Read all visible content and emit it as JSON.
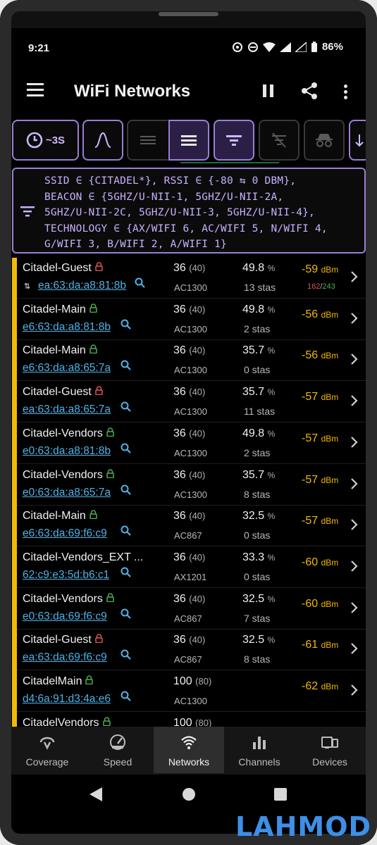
{
  "status": {
    "time": "9:21",
    "battery": "86%"
  },
  "appbar": {
    "title": "WiFi Networks"
  },
  "toolbar": {
    "interval": "~3S"
  },
  "filter": {
    "text": "SSID ∈ {CITADEL*}, RSSI ∈ {-80 ⇆ 0 DBM},\nBEACON ∈ {5GHZ/U-NII-1, 5GHZ/U-NII-2A,\n5GHZ/U-NII-2C, 5GHZ/U-NII-3, 5GHZ/U-NII-4},\nTECHNOLOGY ∈ {AX/WIFI 6, AC/WIFI 5, N/WIFI 4,\nG/WIFI 3, B/WIFI 2, A/WIFI 1}"
  },
  "networks": [
    {
      "ssid": "Citadel-Guest",
      "lock": "red",
      "bssid": "ea:63:da:a8:81:8b",
      "channel": "36",
      "width": "(40)",
      "standard": "AC1300",
      "util": "49.8",
      "util_unit": "%",
      "stas": "13 stas",
      "rssi": "-59",
      "rssi_unit": "dBm",
      "connected": true,
      "rate_rx": "162",
      "rate_tx": "243"
    },
    {
      "ssid": "Citadel-Main",
      "lock": "green",
      "bssid": "e6:63:da:a8:81:8b",
      "channel": "36",
      "width": "(40)",
      "standard": "AC1300",
      "util": "49.8",
      "util_unit": "%",
      "stas": "2 stas",
      "rssi": "-56",
      "rssi_unit": "dBm"
    },
    {
      "ssid": "Citadel-Main",
      "lock": "green",
      "bssid": "e6:63:da:a8:65:7a",
      "channel": "36",
      "width": "(40)",
      "standard": "AC1300",
      "util": "35.7",
      "util_unit": "%",
      "stas": "0 stas",
      "rssi": "-56",
      "rssi_unit": "dBm"
    },
    {
      "ssid": "Citadel-Guest",
      "lock": "red",
      "bssid": "ea:63:da:a8:65:7a",
      "channel": "36",
      "width": "(40)",
      "standard": "AC1300",
      "util": "35.7",
      "util_unit": "%",
      "stas": "11 stas",
      "rssi": "-57",
      "rssi_unit": "dBm"
    },
    {
      "ssid": "Citadel-Vendors",
      "lock": "green",
      "bssid": "e0:63:da:a8:81:8b",
      "channel": "36",
      "width": "(40)",
      "standard": "AC1300",
      "util": "49.8",
      "util_unit": "%",
      "stas": "2 stas",
      "rssi": "-57",
      "rssi_unit": "dBm"
    },
    {
      "ssid": "Citadel-Vendors",
      "lock": "green",
      "bssid": "e0:63:da:a8:65:7a",
      "channel": "36",
      "width": "(40)",
      "standard": "AC1300",
      "util": "35.7",
      "util_unit": "%",
      "stas": "8 stas",
      "rssi": "-57",
      "rssi_unit": "dBm"
    },
    {
      "ssid": "Citadel-Main",
      "lock": "green",
      "bssid": "e6:63:da:69:f6:c9",
      "channel": "36",
      "width": "(40)",
      "standard": "AC867",
      "util": "32.5",
      "util_unit": "%",
      "stas": "0 stas",
      "rssi": "-57",
      "rssi_unit": "dBm"
    },
    {
      "ssid": "Citadel-Vendors_EXT ...",
      "lock": "",
      "bssid": "62:c9:e3:5d:b6:c1",
      "channel": "36",
      "width": "(40)",
      "standard": "AX1201",
      "util": "33.3",
      "util_unit": "%",
      "stas": "0 stas",
      "rssi": "-60",
      "rssi_unit": "dBm"
    },
    {
      "ssid": "Citadel-Vendors",
      "lock": "green",
      "bssid": "e0:63:da:69:f6:c9",
      "channel": "36",
      "width": "(40)",
      "standard": "AC867",
      "util": "32.5",
      "util_unit": "%",
      "stas": "7 stas",
      "rssi": "-60",
      "rssi_unit": "dBm"
    },
    {
      "ssid": "Citadel-Guest",
      "lock": "red",
      "bssid": "ea:63:da:69:f6:c9",
      "channel": "36",
      "width": "(40)",
      "standard": "AC867",
      "util": "32.5",
      "util_unit": "%",
      "stas": "8 stas",
      "rssi": "-61",
      "rssi_unit": "dBm"
    },
    {
      "ssid": "CitadelMain",
      "lock": "green",
      "bssid": "d4:6a:91:d3:4a:e6",
      "channel": "100",
      "width": "(80)",
      "standard": "AC1300",
      "util": "",
      "util_unit": "",
      "stas": "",
      "rssi": "-62",
      "rssi_unit": "dBm"
    },
    {
      "ssid": "CitadelVendors",
      "lock": "green",
      "bssid": "",
      "channel": "100",
      "width": "(80)",
      "standard": "",
      "util": "",
      "util_unit": "",
      "stas": "",
      "rssi": "",
      "rssi_unit": ""
    }
  ],
  "nav": [
    {
      "label": "Coverage",
      "icon": "coverage-icon"
    },
    {
      "label": "Speed",
      "icon": "speed-icon"
    },
    {
      "label": "Networks",
      "icon": "wifi-icon",
      "active": true
    },
    {
      "label": "Channels",
      "icon": "channels-icon"
    },
    {
      "label": "Devices",
      "icon": "devices-icon"
    }
  ],
  "watermark": "LAHMOD",
  "colors": {
    "accent": "#9b7fd6",
    "rssi": "#f0b90b",
    "link": "#4fb3e6",
    "signal_bar": "#f0b90b"
  }
}
